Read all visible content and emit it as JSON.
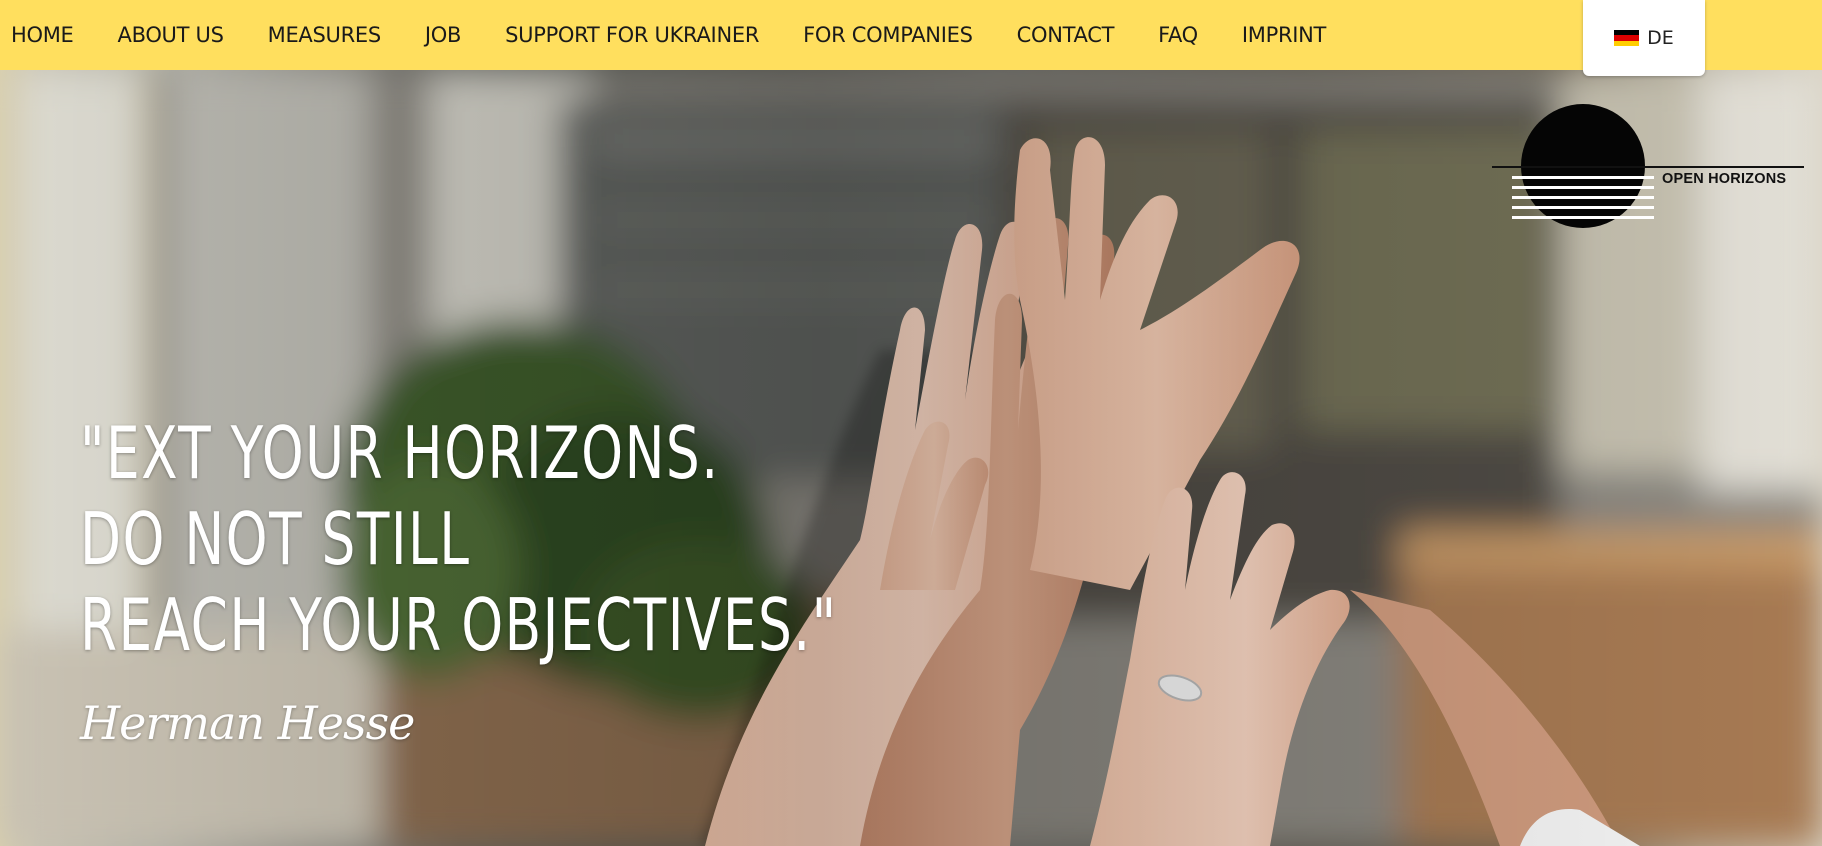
{
  "nav": {
    "items": [
      {
        "label": "HOME"
      },
      {
        "label": "ABOUT US"
      },
      {
        "label": "MEASURES"
      },
      {
        "label": "JOB"
      },
      {
        "label": "SUPPORT FOR UKRAINER"
      },
      {
        "label": "FOR COMPANIES"
      },
      {
        "label": "CONTACT"
      },
      {
        "label": "FAQ"
      },
      {
        "label": "IMPRINT"
      }
    ],
    "bar_color": "#ffdf5e"
  },
  "language": {
    "code": "DE",
    "flag_icon": "german-flag-icon",
    "flag_colors": [
      "#000000",
      "#dd0000",
      "#ffce00"
    ]
  },
  "logo": {
    "text": "OPEN HORIZONS",
    "icon": "sunset-circle-logo"
  },
  "hero": {
    "image": "raised-hands-high-five-photo",
    "quote_lines": [
      "\"EXT YOUR HORIZONS.",
      "DO NOT STILL",
      "REACH YOUR OBJECTIVES.\""
    ],
    "author": "Herman Hesse"
  }
}
